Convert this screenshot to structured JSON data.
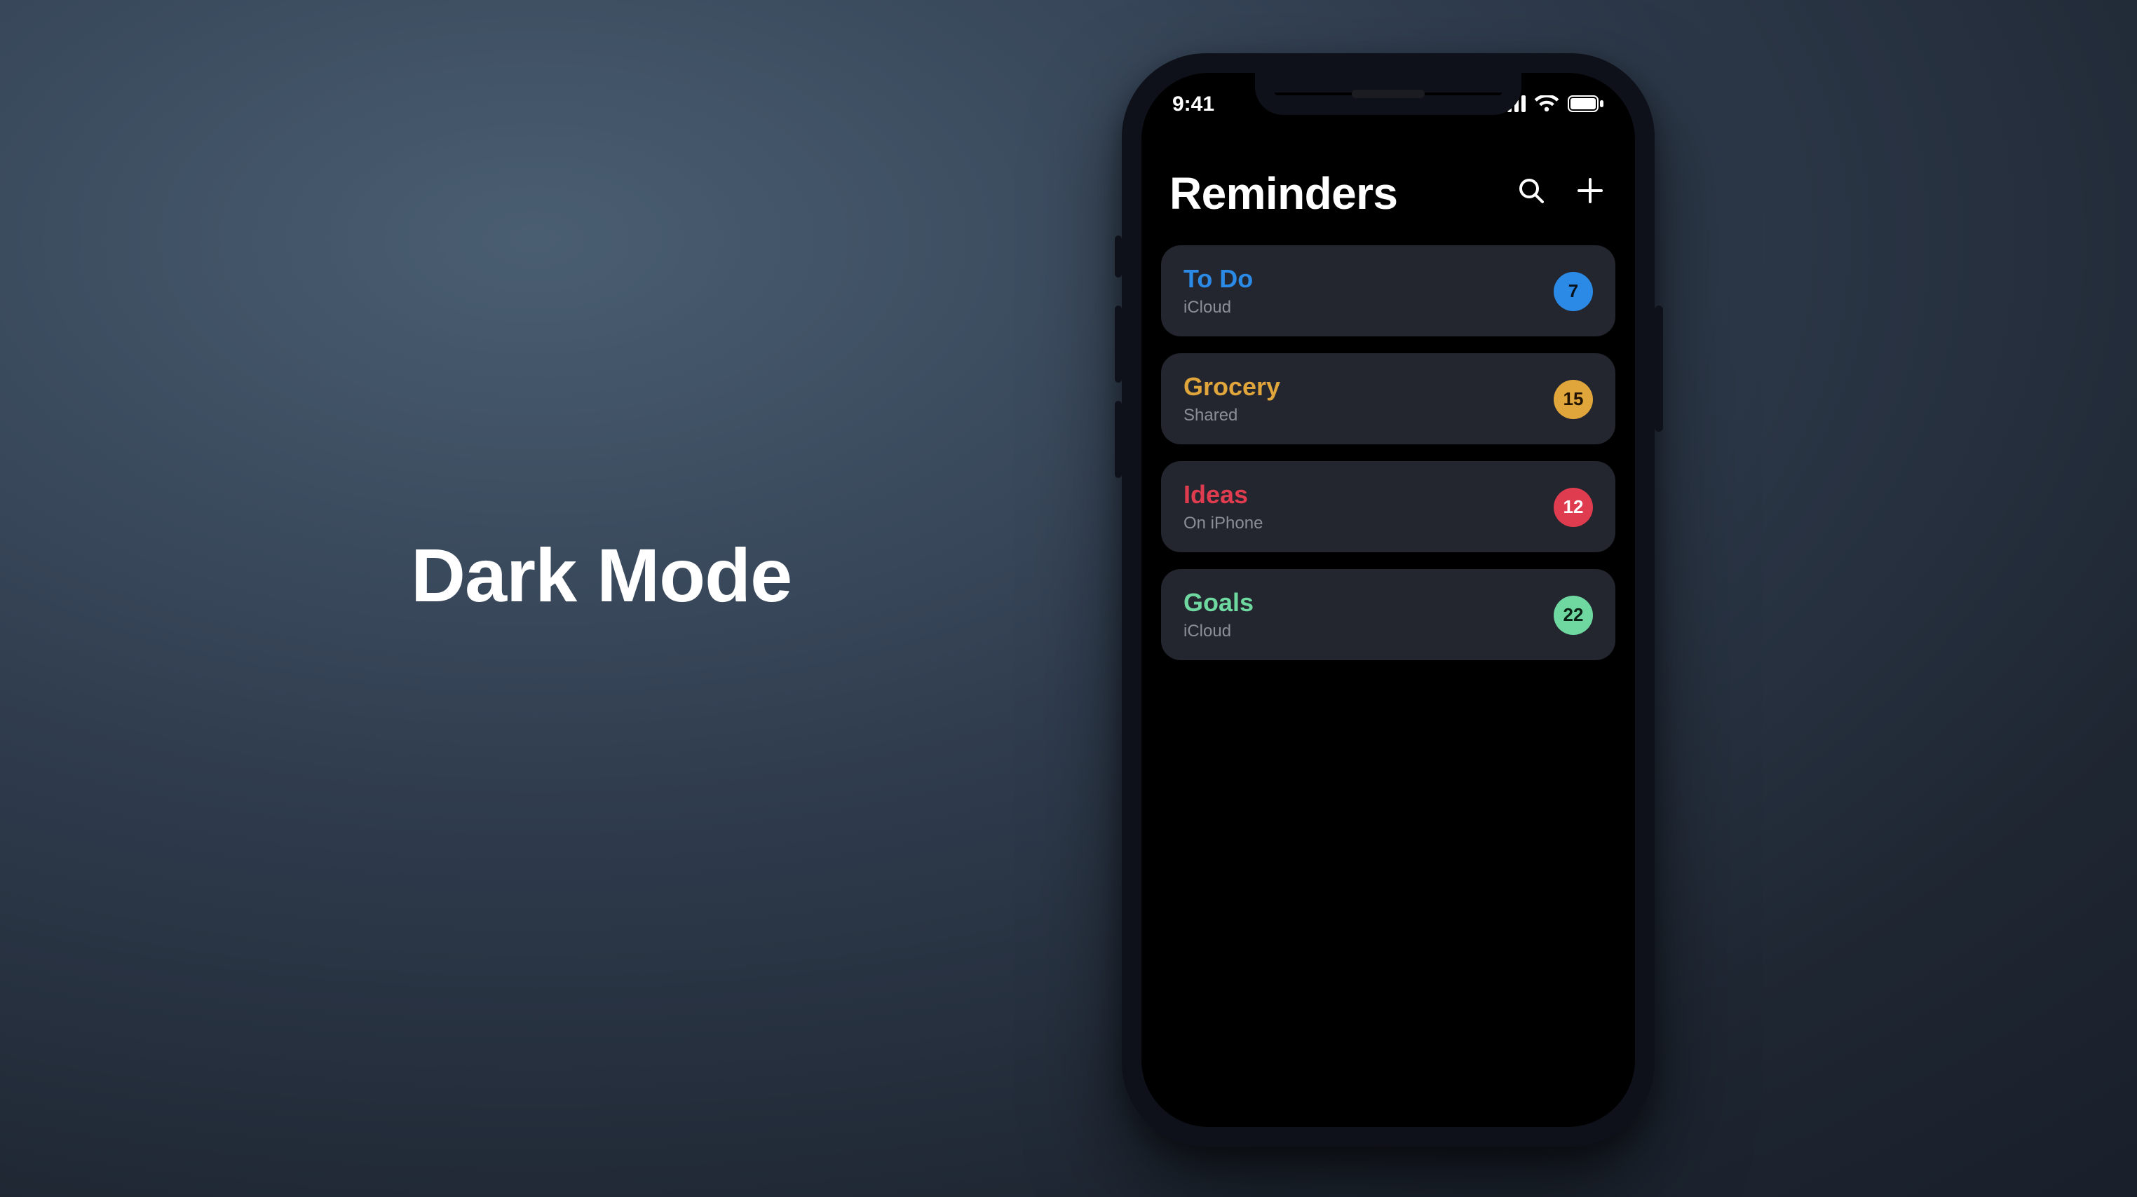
{
  "headline": "Dark Mode",
  "status": {
    "time": "9:41"
  },
  "app": {
    "title": "Reminders"
  },
  "lists": [
    {
      "title": "To Do",
      "subtitle": "iCloud",
      "count": "7",
      "title_color": "#2b8ae6",
      "badge_bg": "#2b8ae6",
      "badge_fg": "#07141f"
    },
    {
      "title": "Grocery",
      "subtitle": "Shared",
      "count": "15",
      "title_color": "#e0a63c",
      "badge_bg": "#e0a63c",
      "badge_fg": "#201300"
    },
    {
      "title": "Ideas",
      "subtitle": "On iPhone",
      "count": "12",
      "title_color": "#e03c4f",
      "badge_bg": "#e03c4f",
      "badge_fg": "#ffffff"
    },
    {
      "title": "Goals",
      "subtitle": "iCloud",
      "count": "22",
      "title_color": "#6fd8a0",
      "badge_bg": "#6fd8a0",
      "badge_fg": "#0a2014"
    }
  ]
}
